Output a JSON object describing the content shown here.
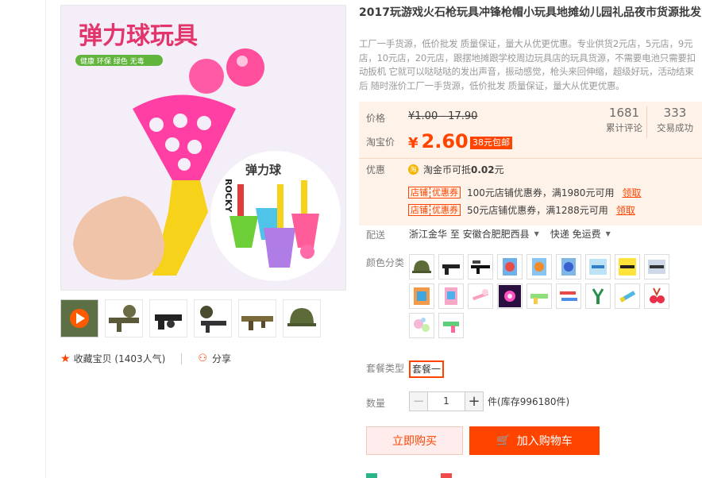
{
  "product": {
    "title": "2017玩游戏火石枪玩具冲锋枪帽小玩具地摊幼儿园礼品夜市货源批发",
    "subtitle": "工厂一手货源，低价批发 质量保证，量大从优更优惠。专业供货2元店，5元店，9元店，10元店，20元店，跟摆地摊跟学校周边玩具店的玩具货源，不需要电池只需要扣动扳机 它就可以哒哒哒的发出声音，振动感觉，枪头来回伸缩，超级好玩，活动结束后 随时涨价工厂一手货源，低价批发 质量保证，量大从优更优惠。"
  },
  "image": {
    "main_text": "弹力球玩具",
    "tags": "健康 环保 绿色 无毒",
    "box_text": "弹力球",
    "rocky": "ROCKY"
  },
  "favorite": {
    "label": "收藏宝贝",
    "count": "(1403人气)"
  },
  "share": {
    "label": "分享"
  },
  "price": {
    "label": "价格",
    "original": "¥1.00 - 17.90",
    "promo_label": "淘宝价",
    "yen": "¥",
    "promo": "2.60",
    "shipping_badge": "38元包邮"
  },
  "stats": {
    "reviews": "1681",
    "reviews_label": "累计评论",
    "trades": "333",
    "trades_label": "交易成功"
  },
  "perks": {
    "label": "优惠",
    "coin_icon": "淘",
    "coin_text": "淘金币可抵",
    "coin_amount": "0.02",
    "coin_unit": "元",
    "coupons": [
      {
        "tag_a": "店铺",
        "tag_b": "优惠券",
        "text": "100元店铺优惠券，满1980元可用",
        "claim": "领取"
      },
      {
        "tag_a": "店铺",
        "tag_b": "优惠券",
        "text": "50元店铺优惠券，满1288元可用",
        "claim": "领取"
      }
    ]
  },
  "delivery": {
    "label": "配送",
    "from": "浙江金华 至",
    "to": "安徽合肥肥西县",
    "method": "快递 免运费"
  },
  "colors": {
    "label": "颜色分类",
    "items": [
      "helmet",
      "pistol-black",
      "rifle-black",
      "toy-package-1",
      "toy-package-2",
      "toy-package-3",
      "water-gun-pack",
      "gun-yellow-card",
      "gun-card",
      "toy-box-orange",
      "toy-bag-pink",
      "toy-pink",
      "light-toy",
      "green-gun",
      "gun-set",
      "slingshot",
      "tube-toy",
      "cherry-toy",
      "bubble-toy",
      "water-gun-green"
    ]
  },
  "package": {
    "label": "套餐类型",
    "option": "套餐一"
  },
  "quantity": {
    "label": "数量",
    "value": "1",
    "minus": "−",
    "plus": "+",
    "unit": "件",
    "stock": "(库存996180件)"
  },
  "actions": {
    "buy": "立即购买",
    "cart": "加入购物车"
  },
  "colors_accent": {
    "primary": "#ff4400",
    "price_bg": "#fff2e8"
  }
}
